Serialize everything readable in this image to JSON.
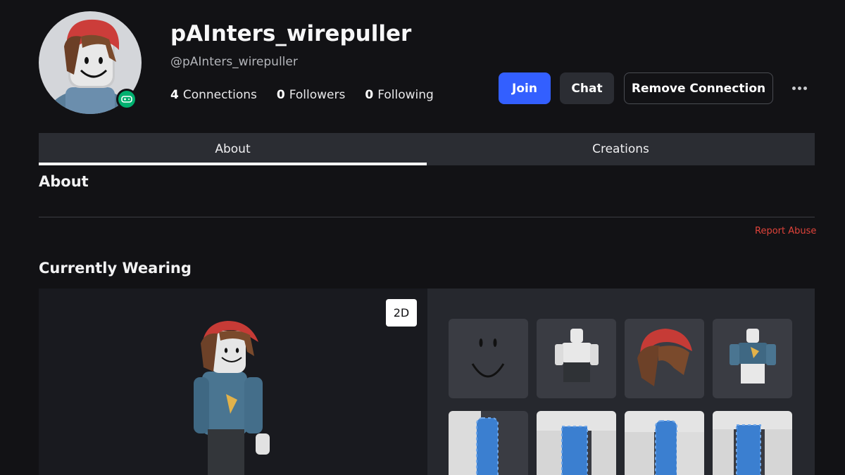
{
  "profile": {
    "display_name": "pAInters_wirepuller",
    "username": "@pAInters_wirepuller",
    "presence_status": "in-game",
    "stats": [
      {
        "count": "4",
        "label": "Connections"
      },
      {
        "count": "0",
        "label": "Followers"
      },
      {
        "count": "0",
        "label": "Following"
      }
    ]
  },
  "actions": {
    "join_label": "Join",
    "chat_label": "Chat",
    "remove_label": "Remove Connection",
    "more_icon": "more-horizontal-icon"
  },
  "tabs": [
    {
      "label": "About",
      "active": true
    },
    {
      "label": "Creations",
      "active": false
    }
  ],
  "about": {
    "title": "About",
    "report_label": "Report Abuse"
  },
  "wearing": {
    "title": "Currently Wearing",
    "view_toggle": "2D",
    "items": [
      {
        "name": "face"
      },
      {
        "name": "pants-outfit"
      },
      {
        "name": "red-beanie-hair"
      },
      {
        "name": "pizza-sweater"
      },
      {
        "name": "left-arm"
      },
      {
        "name": "torso"
      },
      {
        "name": "right-arm"
      },
      {
        "name": "legs"
      }
    ]
  },
  "colors": {
    "background": "#121215",
    "accent_join": "#335fff",
    "report": "#e0433a",
    "presence": "#00b06f"
  }
}
